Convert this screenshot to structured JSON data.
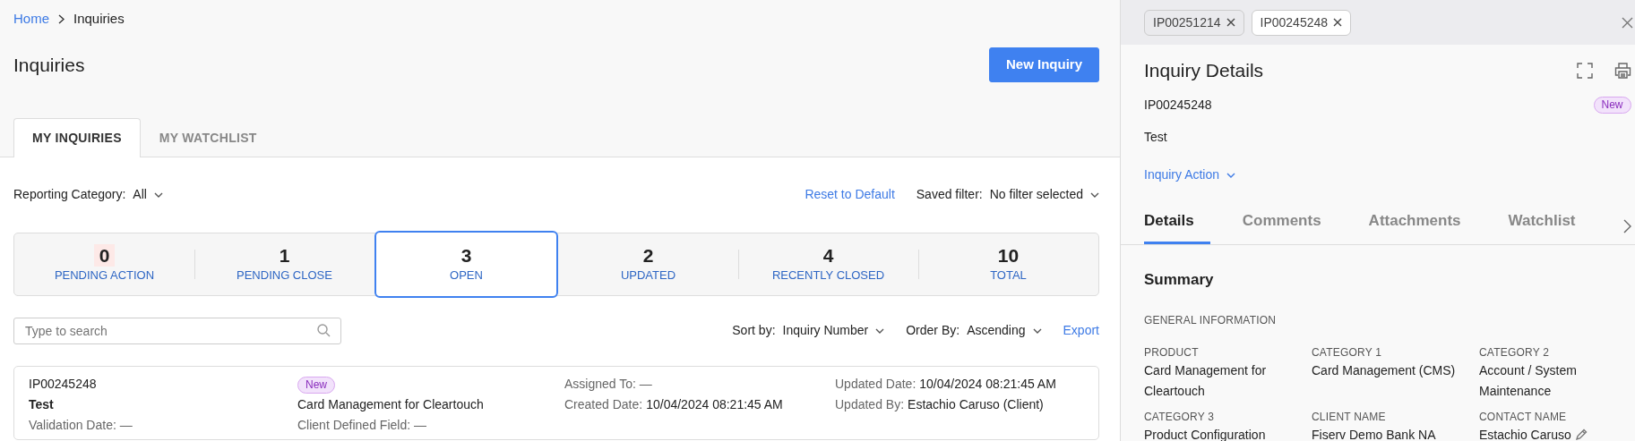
{
  "breadcrumb": [
    {
      "label": "Home",
      "kind": "link"
    },
    {
      "label": "Inquiries",
      "kind": "current"
    }
  ],
  "page_title": "Inquiries",
  "new_button": "New Inquiry",
  "tabs": [
    {
      "label": "MY INQUIRIES",
      "selected": true
    },
    {
      "label": "MY WATCHLIST",
      "selected": false
    }
  ],
  "filters": {
    "reporting_label": "Reporting Category:",
    "reporting_value": "All",
    "reset": "Reset to Default",
    "saved_label": "Saved filter:",
    "saved_value": "No filter selected"
  },
  "stats": [
    {
      "count": "0",
      "label": "PENDING ACTION",
      "selected": false,
      "highlighted": true
    },
    {
      "count": "1",
      "label": "PENDING CLOSE",
      "selected": false,
      "highlighted": false
    },
    {
      "count": "3",
      "label": "OPEN",
      "selected": true,
      "highlighted": false
    },
    {
      "count": "2",
      "label": "UPDATED",
      "selected": false,
      "highlighted": false
    },
    {
      "count": "4",
      "label": "RECENTLY CLOSED",
      "selected": false,
      "highlighted": false
    },
    {
      "count": "10",
      "label": "TOTAL",
      "selected": false,
      "highlighted": false
    }
  ],
  "search": {
    "placeholder": "Type to search"
  },
  "sort": {
    "sort_label": "Sort by:",
    "sort_value": "Inquiry Number",
    "order_label": "Order By:",
    "order_value": "Ascending",
    "export": "Export"
  },
  "inquiries": [
    {
      "columns": [
        [
          {
            "kind": "plain",
            "text": "IP00245248"
          },
          {
            "kind": "bold",
            "text": "Test"
          },
          {
            "kind": "muted",
            "text": "Validation Date: —"
          }
        ],
        [
          {
            "kind": "badge",
            "text": "New"
          },
          {
            "kind": "plain",
            "text": "Card Management for Cleartouch"
          },
          {
            "kind": "muted",
            "text": "Client Defined Field: —"
          }
        ],
        [
          {
            "kind": "muted",
            "text": "Assigned To: —"
          },
          {
            "kind": "field",
            "label": "Created Date:",
            "value": "10/04/2024 08:21:45 AM"
          }
        ],
        [
          {
            "kind": "field",
            "label": "Updated Date:",
            "value": "10/04/2024 08:21:45 AM"
          },
          {
            "kind": "field",
            "label": "Updated By:",
            "value": "Estachio Caruso (Client)"
          }
        ]
      ]
    }
  ],
  "open_tabs": [
    {
      "label": "IP00251214",
      "selected": false
    },
    {
      "label": "IP00245248",
      "selected": true
    }
  ],
  "details": {
    "title": "Inquiry Details",
    "number": "IP00245248",
    "status": "New",
    "subject": "Test",
    "action": "Inquiry Action",
    "tabs": [
      {
        "label": "Details",
        "selected": true
      },
      {
        "label": "Comments",
        "selected": false
      },
      {
        "label": "Attachments",
        "selected": false
      },
      {
        "label": "Watchlist",
        "selected": false
      }
    ],
    "section": "Summary",
    "group": "GENERAL INFORMATION",
    "fields": [
      {
        "label": "PRODUCT",
        "value": "Card Management for Cleartouch",
        "editable": false
      },
      {
        "label": "CATEGORY 1",
        "value": "Card Management (CMS)",
        "editable": false
      },
      {
        "label": "CATEGORY 2",
        "value": "Account / System Maintenance",
        "editable": false
      },
      {
        "label": "CATEGORY 3",
        "value": "Product Configuration",
        "editable": false
      },
      {
        "label": "CLIENT NAME",
        "value": "Fiserv Demo Bank NA",
        "editable": false
      },
      {
        "label": "CONTACT NAME",
        "value": "Estachio Caruso",
        "editable": true
      }
    ]
  }
}
